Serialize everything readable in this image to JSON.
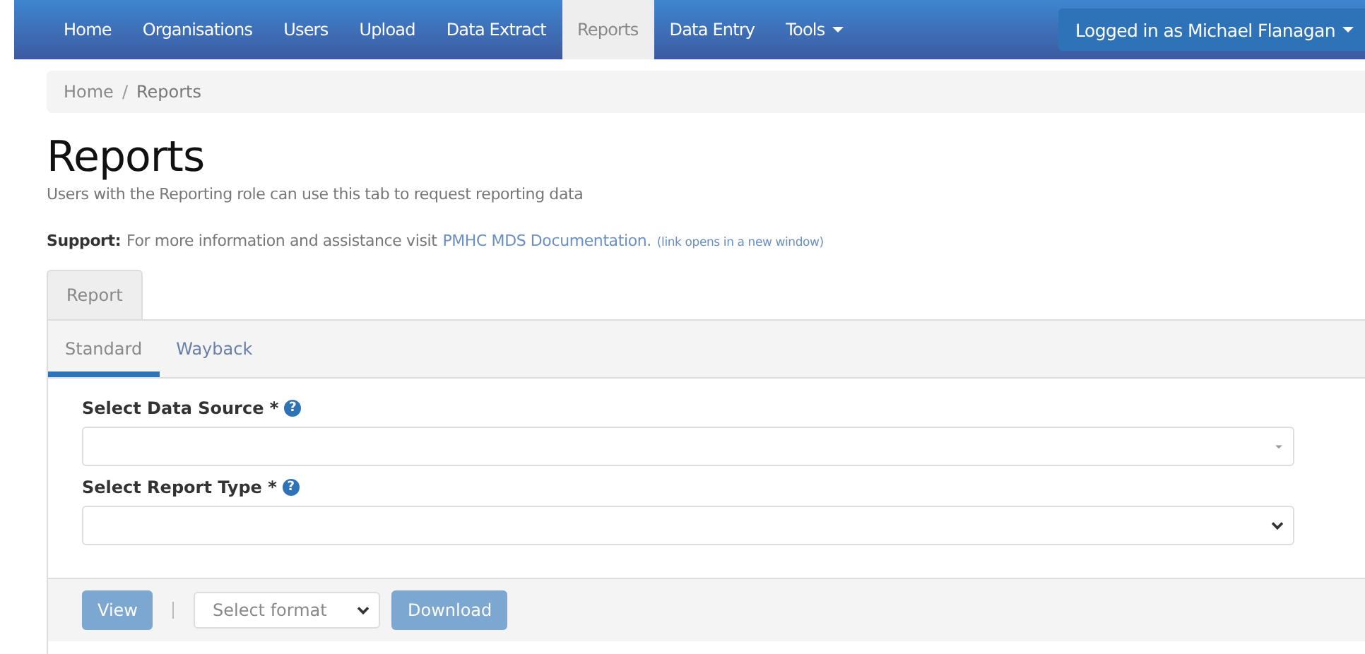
{
  "navbar": {
    "items": [
      {
        "label": "Home",
        "selected": false,
        "dropdown": false
      },
      {
        "label": "Organisations",
        "selected": false,
        "dropdown": false
      },
      {
        "label": "Users",
        "selected": false,
        "dropdown": false
      },
      {
        "label": "Upload",
        "selected": false,
        "dropdown": false
      },
      {
        "label": "Data Extract",
        "selected": false,
        "dropdown": false
      },
      {
        "label": "Reports",
        "selected": true,
        "dropdown": false
      },
      {
        "label": "Data Entry",
        "selected": false,
        "dropdown": false
      },
      {
        "label": "Tools",
        "selected": false,
        "dropdown": true
      }
    ],
    "user": {
      "label": "Logged in as Michael Flanagan",
      "dropdown": true
    }
  },
  "breadcrumb": {
    "items": [
      "Home",
      "Reports"
    ],
    "separator": "/"
  },
  "heading": "Reports",
  "intro": "Users with the Reporting role can use this tab to request reporting data",
  "support": {
    "label": "Support:",
    "text": "For more information and assistance visit",
    "link": "PMHC MDS Documentation.",
    "note": "(link opens in a new window)"
  },
  "tabs": [
    {
      "label": "Report",
      "selected": true
    }
  ],
  "subtabs": [
    {
      "label": "Standard",
      "selected": true
    },
    {
      "label": "Wayback",
      "selected": false
    }
  ],
  "fields": [
    {
      "label": "Select Data Source *",
      "help": "?",
      "kind": "combobox"
    },
    {
      "label": "Select Report Type *",
      "help": "?",
      "kind": "select"
    }
  ],
  "footer": {
    "view": {
      "label": "View",
      "disabled": true
    },
    "format": {
      "placeholder": "Select format"
    },
    "download": {
      "label": "Download",
      "disabled": true
    }
  }
}
